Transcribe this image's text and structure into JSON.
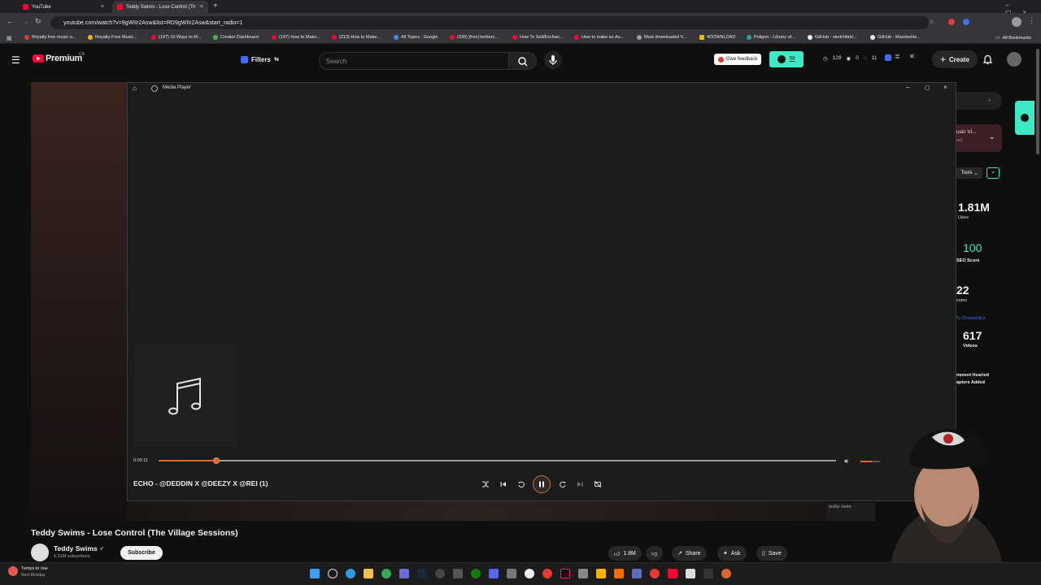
{
  "browser": {
    "tabs": [
      {
        "title": "YouTube"
      },
      {
        "title": "Teddy Swims - Lose Control (Th"
      }
    ],
    "url": "youtube.com/watch?v=9gWIIr2Asw&list=RD9gWIIr2Asw&start_radio=1",
    "bookmarks": [
      "Royalty free music a...",
      "Royalty-Free Music...",
      "(197) 10 Ways to M...",
      "Creator Dashboard",
      "(197) How to Make...",
      "(213) How to Make...",
      "All Topics : Google",
      "(336) [free] kehlani...",
      "How To Sell/Exchan...",
      "How to make an Au...",
      "Most downloaded V...",
      "4DOWNLOAD",
      "Poligon - Library of...",
      "GitHub - sketchfab/...",
      "GitHub - MaximeHe..."
    ],
    "all_bookmarks": "All Bookmarks"
  },
  "youtube": {
    "logo": "Premium",
    "region": "CA",
    "filters": "Filters",
    "search_placeholder": "Search",
    "feedback": "Give feedback",
    "counts": {
      "a": "129",
      "b": "0",
      "c": "11"
    },
    "create": "Create"
  },
  "player": {
    "title": "Media Player",
    "elapsed": "0:00:11",
    "progress": 0.085,
    "track": "ECHO - @DEDDIN X @DEEZY X @REI (1)",
    "volume": 0.6,
    "accent": "#d9692f"
  },
  "side_panel": {
    "music_label": "usic Vi...",
    "music_sub": "ns)",
    "tools": "Tools",
    "likes_value": "1.81M",
    "likes_label": "Likes",
    "seo_value": "100",
    "seo_label": "SEO Score",
    "votes_value": "22",
    "votes_label": "votes",
    "channelytics": "To Channelytics",
    "videos_value": "617",
    "videos_label": "Videos",
    "hearted": "mment Hearted",
    "chapters": "apters Added"
  },
  "video": {
    "title": "Teddy Swims - Lose Control (The Village Sessions)",
    "channel": "Teddy Swims",
    "subscribers": "6.31M subscribers",
    "subscribe": "Subscribe",
    "likes": "1.8M",
    "share": "Share",
    "ask": "Ask",
    "save": "Save",
    "overlay_text": "teddy swim"
  },
  "taskbar": {
    "weather": "Temps to rise",
    "weather_sub": "Next Monday"
  }
}
